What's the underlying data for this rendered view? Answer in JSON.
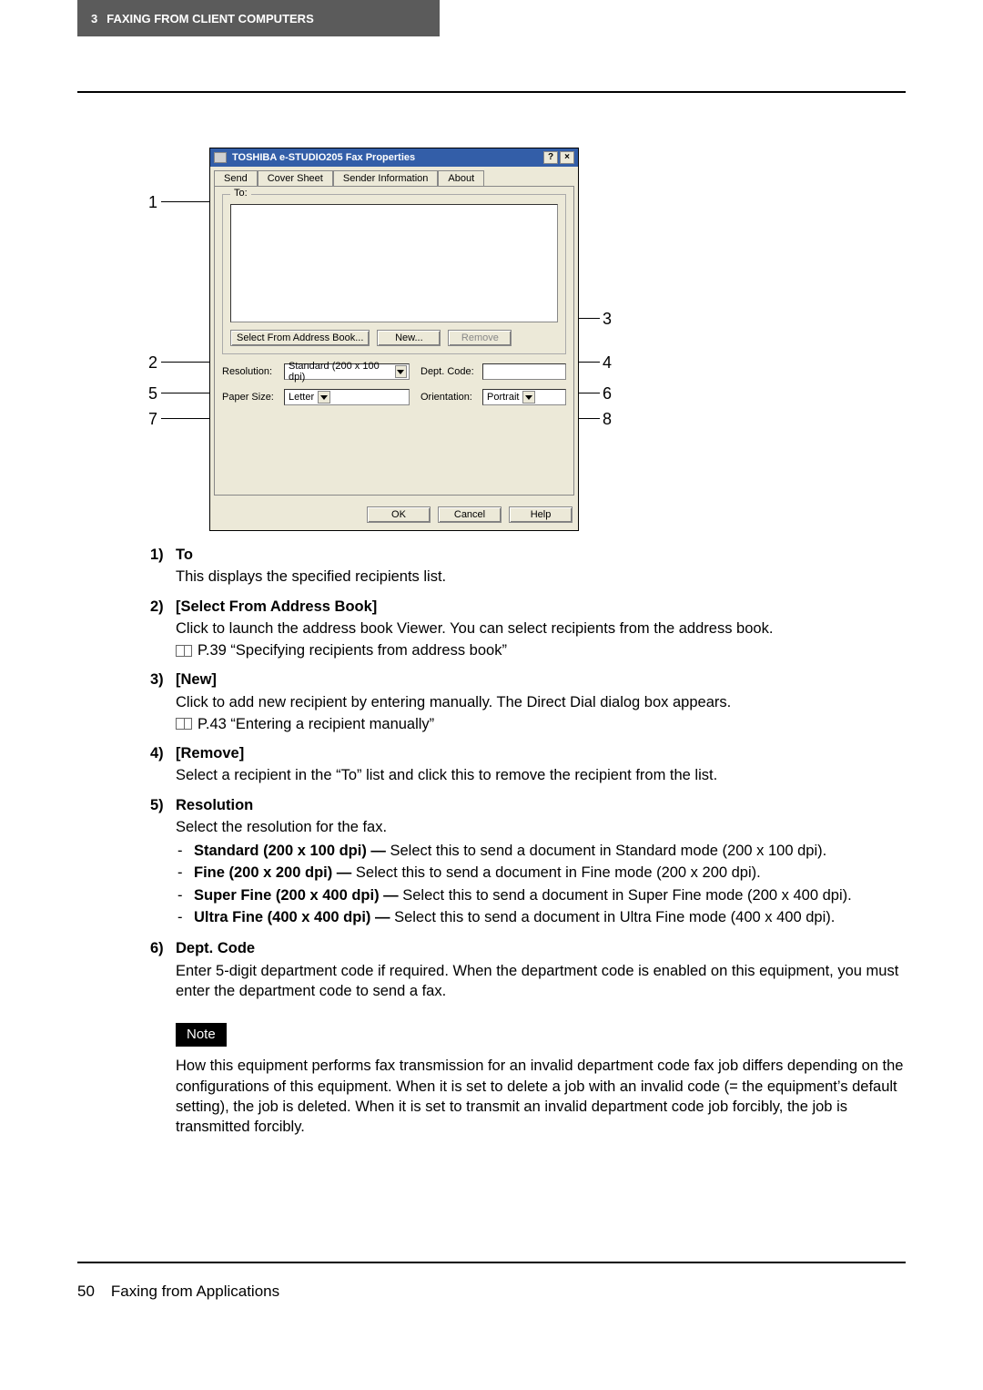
{
  "header": {
    "chapter_num": "3",
    "chapter_title": "FAXING FROM CLIENT COMPUTERS"
  },
  "dialog": {
    "title": "TOSHIBA e-STUDIO205 Fax Properties",
    "help_btn": "?",
    "close_btn": "×",
    "tabs": {
      "send": "Send",
      "cover": "Cover Sheet",
      "sender": "Sender Information",
      "about": "About"
    },
    "to_label": "To:",
    "btn_select_book": "Select From Address Book...",
    "btn_new": "New...",
    "btn_remove": "Remove",
    "res_label": "Resolution:",
    "res_value": "Standard (200 x 100 dpi)",
    "dept_label": "Dept. Code:",
    "paper_label": "Paper Size:",
    "paper_value": "Letter",
    "orient_label": "Orientation:",
    "orient_value": "Portrait",
    "ok": "OK",
    "cancel": "Cancel",
    "help": "Help"
  },
  "callouts": {
    "c1": "1",
    "c2": "2",
    "c3": "3",
    "c4": "4",
    "c5": "5",
    "c6": "6",
    "c7": "7",
    "c8": "8"
  },
  "list": {
    "i1": {
      "num": "1)",
      "title": "To",
      "text": "This displays the specified recipients list."
    },
    "i2": {
      "num": "2)",
      "title": "[Select From Address Book]",
      "text": "Click to launch the address book Viewer. You can select recipients from the address book.",
      "ref": "P.39 “Specifying recipients from address book”"
    },
    "i3": {
      "num": "3)",
      "title": "[New]",
      "text": "Click to add new recipient by entering manually. The Direct Dial dialog box appears.",
      "ref": "P.43 “Entering a recipient manually”"
    },
    "i4": {
      "num": "4)",
      "title": "[Remove]",
      "text": "Select a recipient in the “To” list and click this to remove the recipient from the list."
    },
    "i5": {
      "num": "5)",
      "title": "Resolution",
      "text": "Select the resolution for the fax.",
      "opts": {
        "a": {
          "b": "Standard (200 x 100 dpi) — ",
          "t": "Select this to send a document in Standard mode (200 x 100 dpi)."
        },
        "b": {
          "b": "Fine (200 x 200 dpi) — ",
          "t": "Select this to send a document in Fine mode (200 x 200 dpi)."
        },
        "c": {
          "b": "Super Fine (200 x 400 dpi) — ",
          "t": "Select this to send a document in Super Fine mode (200 x 400 dpi)."
        },
        "d": {
          "b": "Ultra Fine (400 x 400 dpi) — ",
          "t": "Select this to send a document in Ultra Fine mode (400 x 400 dpi)."
        }
      }
    },
    "i6": {
      "num": "6)",
      "title": "Dept. Code",
      "text": "Enter 5-digit department code if required. When the department code is enabled on this equipment, you must enter the department code to send a fax."
    }
  },
  "note": {
    "label": "Note",
    "text": "How this equipment performs fax transmission for an invalid department code fax job differs depending on the configurations of this equipment. When it is set to delete a job with an invalid code (= the equipment’s default setting), the job is deleted. When it is set to transmit an invalid department code job forcibly, the job is transmitted forcibly."
  },
  "footer": {
    "page": "50",
    "section": "Faxing from Applications"
  }
}
